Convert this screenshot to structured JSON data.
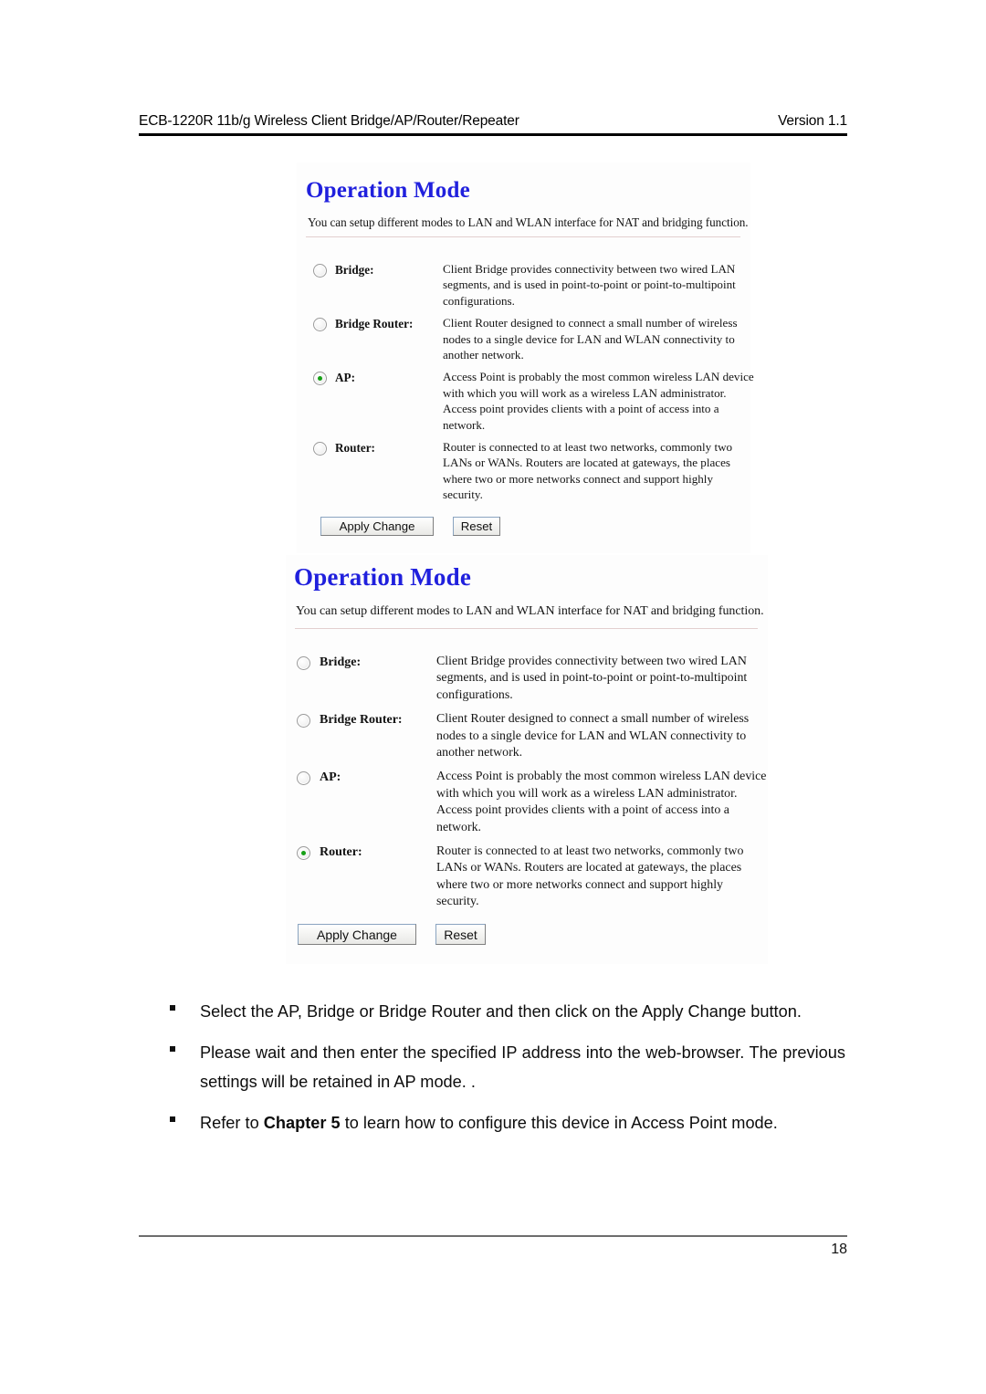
{
  "header": {
    "left_title": "ECB-1220R 11b/g Wireless Client Bridge/AP/Router/Repeater",
    "right_version": "Version 1.1"
  },
  "colors": {
    "heading_blue": "#2020dd",
    "radio_selected_green": "#16a016",
    "divider_pink": "#e3cfcf",
    "button_border_blue": "#8aa4c0"
  },
  "panels": [
    {
      "title": "Operation Mode",
      "intro": "You can setup different modes to LAN and WLAN interface for NAT and bridging function.",
      "selected": "AP",
      "options": [
        {
          "id": "bridge",
          "label": "Bridge:",
          "checked": false,
          "desc_lines": [
            "Client Bridge provides connectivity between two wired LAN",
            "segments, and is used in point-to-point or point-to-multipoint",
            "configurations."
          ]
        },
        {
          "id": "bridge-router",
          "label": "Bridge Router:",
          "checked": false,
          "desc_lines": [
            "Client Router designed to connect a small number of wireless",
            "nodes to a single device for LAN and WLAN connectivity to",
            "another network."
          ]
        },
        {
          "id": "ap",
          "label": "AP:",
          "checked": true,
          "desc_lines": [
            "Access Point is probably the most common wireless LAN device",
            "with which you will work as a wireless LAN administrator.",
            "Access point provides clients with a point of access into a",
            "network."
          ]
        },
        {
          "id": "router",
          "label": "Router:",
          "checked": false,
          "desc_lines": [
            "Router is connected to at least two networks, commonly two",
            "LANs or WANs. Routers are located at gateways, the places",
            "where two or more networks connect and support highly",
            "security."
          ]
        }
      ],
      "buttons": {
        "apply": "Apply Change",
        "reset": "Reset"
      }
    },
    {
      "title": "Operation Mode",
      "intro": "You can setup different modes to LAN and WLAN interface for NAT and bridging function.",
      "selected": "Router",
      "options": [
        {
          "id": "bridge",
          "label": "Bridge:",
          "checked": false,
          "desc_lines": [
            "Client Bridge provides connectivity between two wired LAN",
            "segments, and is used in point-to-point or point-to-multipoint",
            "configurations."
          ]
        },
        {
          "id": "bridge-router",
          "label": "Bridge Router:",
          "checked": false,
          "desc_lines": [
            "Client Router designed to connect a small number of wireless",
            "nodes to a single device for LAN and WLAN connectivity to",
            "another network."
          ]
        },
        {
          "id": "ap",
          "label": "AP:",
          "checked": false,
          "desc_lines": [
            "Access Point is probably the most common wireless LAN device",
            "with which you will work as a wireless LAN administrator.",
            "Access point provides clients with a point of access into a",
            "network."
          ]
        },
        {
          "id": "router",
          "label": "Router:",
          "checked": true,
          "desc_lines": [
            "Router is connected to at least two networks, commonly two",
            "LANs or WANs. Routers are located at gateways, the places",
            "where two or more networks connect and support highly",
            "security."
          ]
        }
      ],
      "buttons": {
        "apply": "Apply Change",
        "reset": "Reset"
      }
    }
  ],
  "bullets": [
    {
      "text": "Select the AP, Bridge or Bridge Router and then click on the Apply Change button.",
      "justify": false,
      "bold_segment": ""
    },
    {
      "text": "Please wait and then enter the specified IP address into the web-browser. The previous settings will be retained in AP mode. .",
      "justify": true,
      "bold_segment": ""
    },
    {
      "text_before": "Refer to ",
      "bold_segment": "Chapter 5",
      "text_after": " to learn how to configure this device in Access Point mode.",
      "justify": false
    }
  ],
  "footer": {
    "page_number": "18"
  }
}
